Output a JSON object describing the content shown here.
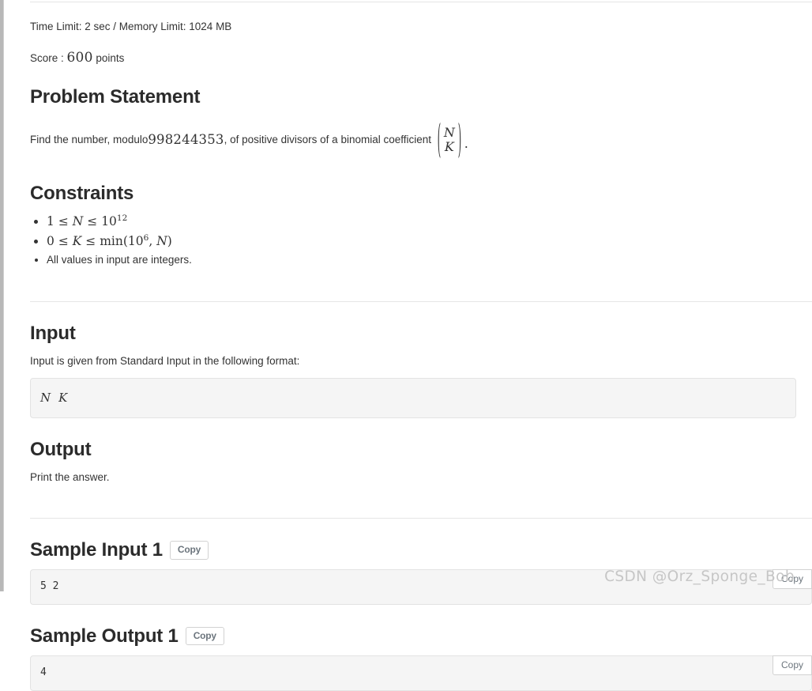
{
  "limits": {
    "text": "Time Limit: 2 sec / Memory Limit: 1024 MB"
  },
  "score": {
    "label": "Score : ",
    "value": "600",
    "suffix": " points"
  },
  "problem_statement": {
    "heading": "Problem Statement",
    "text_before": "Find the number, modulo ",
    "modulus": "998244353",
    "text_after": ", of positive divisors of a binomial coefficient ",
    "binomial": {
      "open": "(",
      "top": "N",
      "bottom": "K",
      "close": ")"
    },
    "period": "."
  },
  "constraints": {
    "heading": "Constraints",
    "items": [
      {
        "type": "math",
        "parts": {
          "lhs": "1",
          "op1": "≤",
          "var": "N",
          "op2": "≤",
          "base": "10",
          "exp": "12"
        }
      },
      {
        "type": "math",
        "parts": {
          "lhs": "0",
          "op1": "≤",
          "var": "K",
          "op2": "≤",
          "fn": "min(",
          "base": "10",
          "exp": "6",
          "sep": ", ",
          "var2": "N",
          "close": ")"
        }
      },
      {
        "type": "text",
        "text": "All values in input are integers."
      }
    ]
  },
  "input": {
    "heading": "Input",
    "description": "Input is given from Standard Input in the following format:",
    "format": {
      "var1": "N",
      "var2": "K"
    }
  },
  "output": {
    "heading": "Output",
    "description": "Print the answer."
  },
  "samples": [
    {
      "heading": "Sample Input 1",
      "copy_label": "Copy",
      "float_copy_label": "Copy",
      "content": "5 2"
    },
    {
      "heading": "Sample Output 1",
      "copy_label": "Copy",
      "float_copy_label": "Copy",
      "content": "4"
    }
  ],
  "watermark": {
    "text": "CSDN @Orz_Sponge_Bob"
  }
}
